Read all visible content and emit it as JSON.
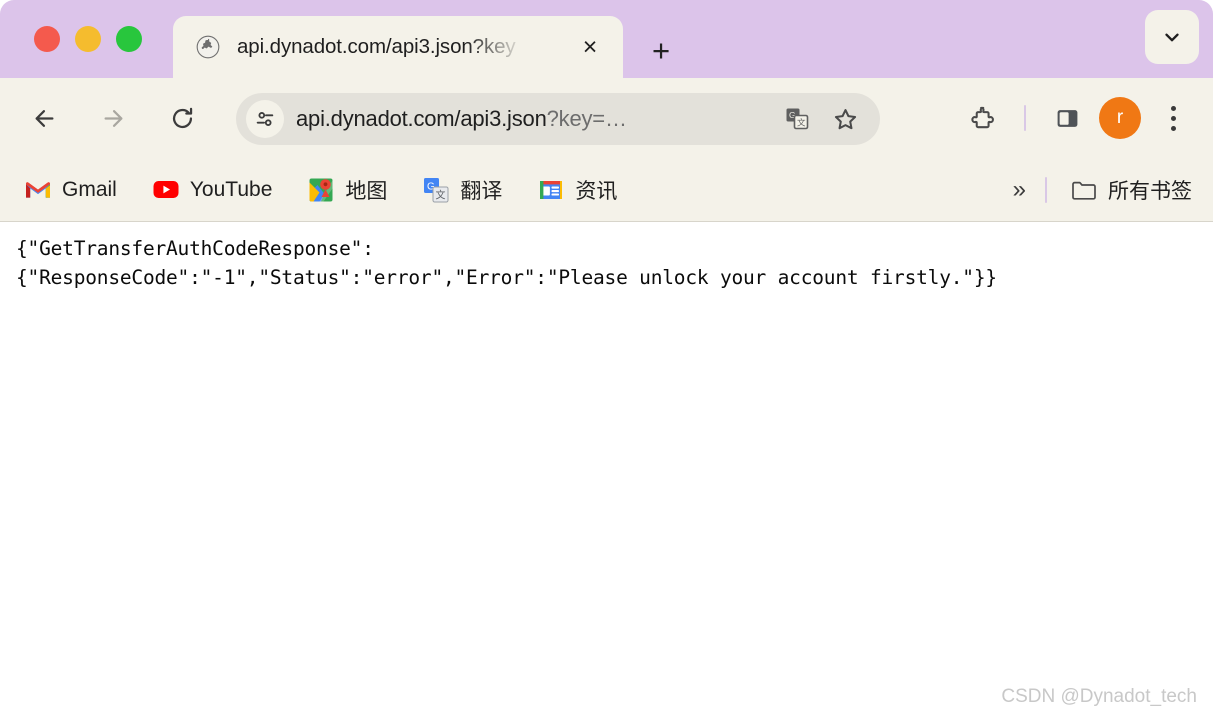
{
  "window": {
    "traffic_lights": [
      {
        "name": "close",
        "color": "#f45a4d"
      },
      {
        "name": "minimize",
        "color": "#f5bc2e"
      },
      {
        "name": "zoom",
        "color": "#28c63d"
      }
    ],
    "tabstrip_color": "#dcc4ea",
    "chrome_color": "#f4f2e9"
  },
  "tab": {
    "title": "api.dynadot.com/api3.json?key",
    "favicon": "globe-icon",
    "close_label": "×"
  },
  "new_tab": {
    "label": "+"
  },
  "tab_search": {
    "label": "⌄"
  },
  "toolbar": {
    "back_label": "←",
    "forward_label": "→",
    "reload_label": "↻",
    "extensions_name": "puzzle-piece-icon",
    "side_panel_name": "side-panel-icon",
    "profile_initial": "r",
    "menu_name": "three-dot-menu-icon"
  },
  "omnibox": {
    "site_settings_icon": "tune-icon",
    "url_visible": "api.dynadot.com/api3.json",
    "url_query": "?key=…",
    "translate_icon": "translate-icon",
    "bookmark_icon": "star-outline-icon"
  },
  "bookmarks": {
    "items": [
      {
        "label": "Gmail",
        "icon": "gmail-icon"
      },
      {
        "label": "YouTube",
        "icon": "youtube-icon"
      },
      {
        "label": "地图",
        "icon": "google-maps-icon"
      },
      {
        "label": "翻译",
        "icon": "google-translate-icon"
      },
      {
        "label": "资讯",
        "icon": "google-news-icon"
      }
    ],
    "overflow_label": "»",
    "all_bookmarks_label": "所有书签",
    "all_bookmarks_icon": "folder-icon"
  },
  "page": {
    "response_text": "{\"GetTransferAuthCodeResponse\":\n{\"ResponseCode\":\"-1\",\"Status\":\"error\",\"Error\":\"Please unlock your account firstly.\"}}",
    "watermark": "CSDN @Dynadot_tech"
  }
}
